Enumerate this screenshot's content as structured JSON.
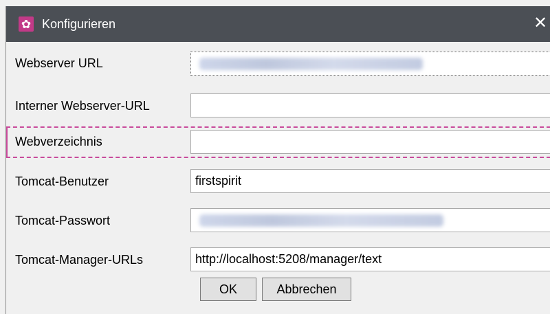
{
  "window": {
    "title": "Konfigurieren",
    "icon": "gear-icon",
    "close_glyph": "✕"
  },
  "form": {
    "fields": [
      {
        "label": "Webserver URL",
        "value": "",
        "state": "blurred"
      },
      {
        "label": "Interner Webserver-URL",
        "value": ""
      },
      {
        "label": "Webverzeichnis",
        "value": "",
        "state": "focused"
      },
      {
        "label": "Tomcat-Benutzer",
        "value": "firstspirit"
      },
      {
        "label": "Tomcat-Passwort",
        "value": "",
        "state": "blurred"
      },
      {
        "label": "Tomcat-Manager-URLs",
        "value": "http://localhost:5208/manager/text"
      }
    ]
  },
  "buttons": {
    "ok": "OK",
    "cancel": "Abbrechen"
  },
  "colors": {
    "titlebar": "#4b4f55",
    "icon_bg": "#c23a88",
    "focus": "#c84a9b"
  }
}
